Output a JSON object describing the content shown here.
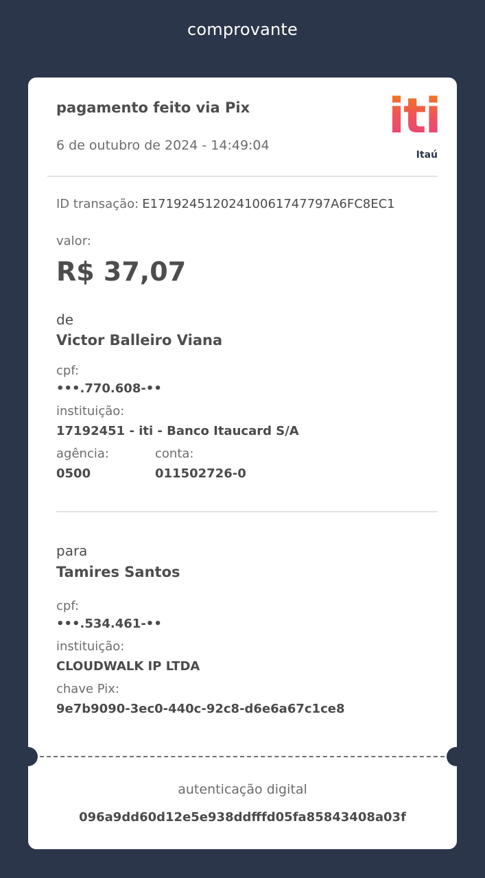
{
  "header": {
    "title": "comprovante"
  },
  "receipt": {
    "title": "pagamento feito via Pix",
    "datetime": "6 de outubro de 2024 - 14:49:04",
    "brand": {
      "logo_text": "iti",
      "sub": "Itaú",
      "colors": [
        "#f07a1a",
        "#e9437a"
      ]
    },
    "transaction_label": "ID transação:",
    "transaction_id": "E17192451202410061747797A6FC8EC1",
    "amount_label": "valor:",
    "amount": "R$ 37,07",
    "from": {
      "section_label": "de",
      "name": "Victor Balleiro Viana",
      "cpf_label": "cpf:",
      "cpf": "•••.770.608-••",
      "institution_label": "instituição:",
      "institution": "17192451 - iti - Banco Itaucard S/A",
      "agency_label": "agência:",
      "agency": "0500",
      "account_label": "conta:",
      "account": "011502726-0"
    },
    "to": {
      "section_label": "para",
      "name": "Tamires Santos",
      "cpf_label": "cpf:",
      "cpf": "•••.534.461-••",
      "institution_label": "instituição:",
      "institution": "CLOUDWALK IP LTDA",
      "pix_key_label": "chave Pix:",
      "pix_key": "9e7b9090-3ec0-440c-92c8-d6e6a67c1ce8"
    },
    "authentication": {
      "label": "autenticação digital",
      "code": "096a9dd60d12e5e938ddfffd05fa85843408a03f"
    }
  },
  "colors": {
    "background": "#2b364a",
    "card": "#ffffff",
    "text": "#4a4a4a"
  }
}
